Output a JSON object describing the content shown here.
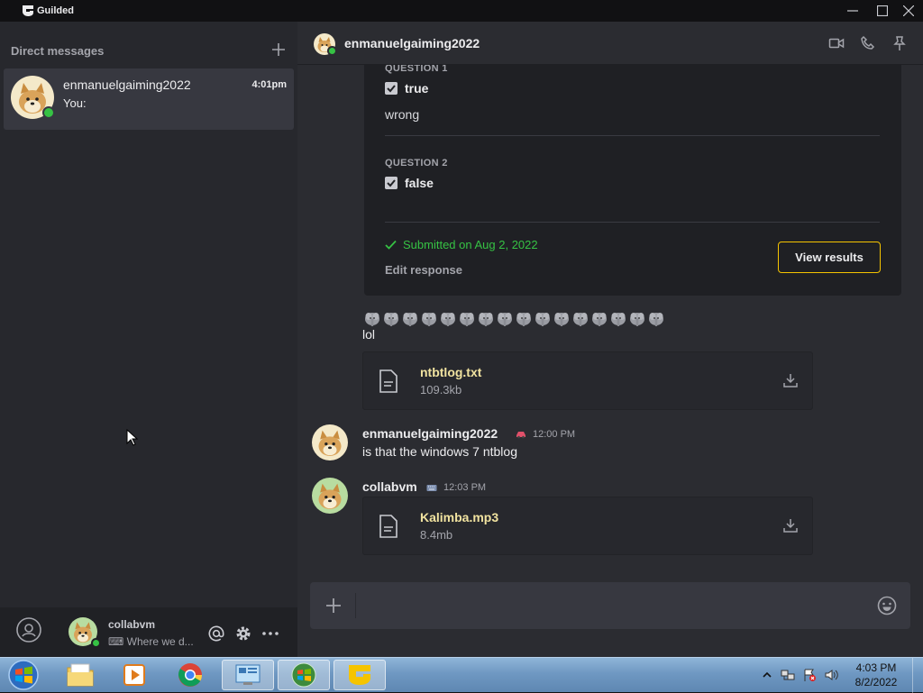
{
  "titlebar": {
    "app_name": "Guilded"
  },
  "sidebar": {
    "header": "Direct messages",
    "dm": {
      "name": "enmanuelgaiming2022",
      "time": "4:01pm",
      "preview": "You:"
    },
    "user": {
      "name": "collabvm",
      "status": "⌨ Where we d..."
    }
  },
  "chat": {
    "header_name": "enmanuelgaiming2022",
    "form": {
      "q1_label": "QUESTION 1",
      "q1_answer": "true",
      "q1_text": "wrong",
      "q2_label": "QUESTION 2",
      "q2_answer": "false",
      "submitted": "Submitted on Aug 2, 2022",
      "edit_response": "Edit response",
      "view_results": "View results"
    },
    "msg_lol": "lol",
    "file1": {
      "name": "ntbtlog.txt",
      "size": "109.3kb"
    },
    "msg2": {
      "author": "enmanuelgaiming2022",
      "time": "12:00 PM",
      "text": "is that the windows 7 ntblog"
    },
    "msg3": {
      "author": "collabvm",
      "time": "12:03 PM"
    },
    "file2": {
      "name": "Kalimba.mp3",
      "size": "8.4mb"
    }
  },
  "taskbar": {
    "time": "4:03 PM",
    "date": "8/2/2022"
  },
  "colors": {
    "accent": "#f5c400",
    "online": "#36c244",
    "file_name": "#f1e3a0"
  }
}
